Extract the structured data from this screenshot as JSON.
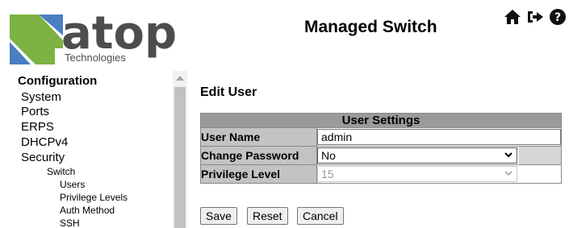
{
  "header": {
    "logo_word": "atop",
    "logo_sub": "Technologies",
    "title": "Managed Switch",
    "icons": [
      "home-icon",
      "logout-icon",
      "help-icon"
    ]
  },
  "sidebar": {
    "heading": "Configuration",
    "items": [
      {
        "label": "System"
      },
      {
        "label": "Ports"
      },
      {
        "label": "ERPS"
      },
      {
        "label": "DHCPv4"
      },
      {
        "label": "Security"
      },
      {
        "label": "Switch"
      },
      {
        "label": "Users"
      },
      {
        "label": "Privilege Levels"
      },
      {
        "label": "Auth Method"
      },
      {
        "label": "SSH"
      }
    ]
  },
  "main": {
    "title": "Edit User",
    "table": {
      "header": "User Settings",
      "rows": [
        {
          "label": "User Name",
          "value": "admin"
        },
        {
          "label": "Change Password",
          "value": "No"
        },
        {
          "label": "Privilege Level",
          "value": "15"
        }
      ]
    },
    "buttons": {
      "save": "Save",
      "reset": "Reset",
      "cancel": "Cancel"
    }
  },
  "colors": {
    "logo_green": "#7cb342",
    "logo_blue": "#4a7fc1",
    "logo_gray": "#4d4d4d"
  }
}
